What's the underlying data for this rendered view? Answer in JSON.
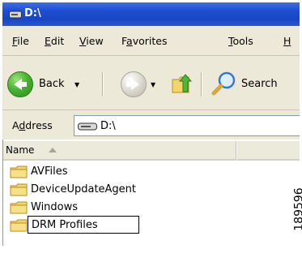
{
  "window": {
    "title": "D:\\"
  },
  "menu": {
    "file": {
      "u": "F",
      "rest": "ile"
    },
    "edit": {
      "u": "E",
      "rest": "dit"
    },
    "view": {
      "u": "V",
      "rest": "iew"
    },
    "favorites": {
      "pre": "F",
      "u": "a",
      "rest": "vorites"
    },
    "tools": {
      "u": "T",
      "rest": "ools"
    },
    "help": {
      "u": "H",
      "rest": ""
    }
  },
  "toolbar": {
    "back_label": "Back",
    "search_label": "Search"
  },
  "address": {
    "label_pre": "A",
    "label_u": "d",
    "label_rest": "dress",
    "value": "D:\\"
  },
  "list": {
    "header": {
      "name": "Name"
    },
    "items": [
      {
        "name": "AVFiles"
      },
      {
        "name": "DeviceUpdateAgent"
      },
      {
        "name": "Windows"
      },
      {
        "name": "DRM Profiles",
        "editing": true
      }
    ]
  },
  "figure_number": "189596",
  "colors": {
    "titlebar": "#1f4fd1",
    "folder": "#f3d56b",
    "back_green": "#47b52f"
  }
}
